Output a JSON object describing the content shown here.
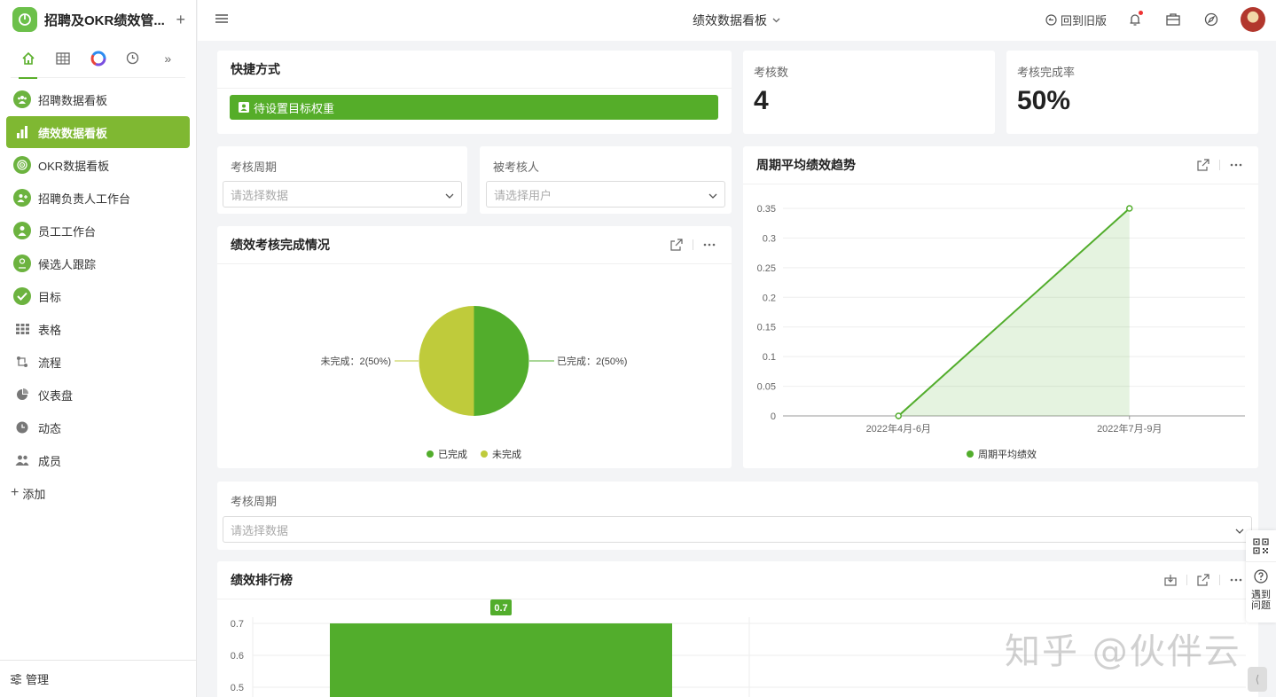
{
  "app": {
    "name": "招聘及OKR绩效管...",
    "add": "+"
  },
  "icon_tabs": [
    "home-icon",
    "table-icon",
    "dashboard-color-icon",
    "clock-icon",
    "expand-icon"
  ],
  "menu": [
    {
      "label": "招聘数据看板",
      "icon": "team-icon"
    },
    {
      "label": "绩效数据看板",
      "icon": "bar-chart-icon",
      "active": true
    },
    {
      "label": "OKR数据看板",
      "icon": "target-icon"
    },
    {
      "label": "招聘负责人工作台",
      "icon": "user-add-icon"
    },
    {
      "label": "员工工作台",
      "icon": "person-icon"
    },
    {
      "label": "候选人跟踪",
      "icon": "person-icon"
    },
    {
      "label": "目标",
      "icon": "check-icon"
    },
    {
      "label": "表格",
      "icon": "grid-icon"
    },
    {
      "label": "流程",
      "icon": "flow-icon"
    },
    {
      "label": "仪表盘",
      "icon": "pie-icon"
    },
    {
      "label": "动态",
      "icon": "clock-icon"
    },
    {
      "label": "成员",
      "icon": "members-icon"
    }
  ],
  "sidebar": {
    "add_label": "添加",
    "manage_label": "管理"
  },
  "topbar": {
    "title": "绩效数据看板",
    "back_old": "回到旧版"
  },
  "shortcut": {
    "title": "快捷方式",
    "button": "待设置目标权重"
  },
  "stats": [
    {
      "label": "考核数",
      "value": "4"
    },
    {
      "label": "考核完成率",
      "value": "50%"
    }
  ],
  "filters": {
    "period_label": "考核周期",
    "period_placeholder": "请选择数据",
    "person_label": "被考核人",
    "person_placeholder": "请选择用户"
  },
  "pie_card": {
    "title": "绩效考核完成情况",
    "label_left": "未完成：2(50%)",
    "label_right": "已完成：2(50%)"
  },
  "line_card": {
    "title": "周期平均绩效趋势"
  },
  "filter2": {
    "label": "考核周期",
    "placeholder": "请选择数据"
  },
  "rank_card": {
    "title": "绩效排行榜",
    "bar_label": "0.7"
  },
  "side_float": {
    "help": "遇到问题"
  },
  "watermark": "知乎 @伙伴云",
  "colors": {
    "accent": "#55ad29",
    "active_menu": "#7fb832",
    "incomplete": "#bfcb3b"
  },
  "chart_data": [
    {
      "type": "pie",
      "categories": [
        "已完成",
        "未完成"
      ],
      "values": [
        2,
        2
      ],
      "colors": [
        "#52ad2c",
        "#bfcb3b"
      ],
      "legend": "bottom"
    },
    {
      "type": "area",
      "categories": [
        "2022年4月-6月",
        "2022年7月-9月"
      ],
      "series": [
        {
          "name": "周期平均绩效",
          "values": [
            0,
            0.35
          ]
        }
      ],
      "y_ticks": [
        "0.35",
        "0.3",
        "0.25",
        "0.2",
        "0.15",
        "0.1",
        "0.05",
        "0"
      ],
      "ylim": [
        0,
        0.35
      ],
      "legend": "bottom"
    },
    {
      "type": "bar",
      "values": [
        0.7
      ],
      "y_ticks": [
        "0.7",
        "0.6",
        "0.5"
      ],
      "ylim": [
        0.5,
        0.7
      ]
    }
  ]
}
